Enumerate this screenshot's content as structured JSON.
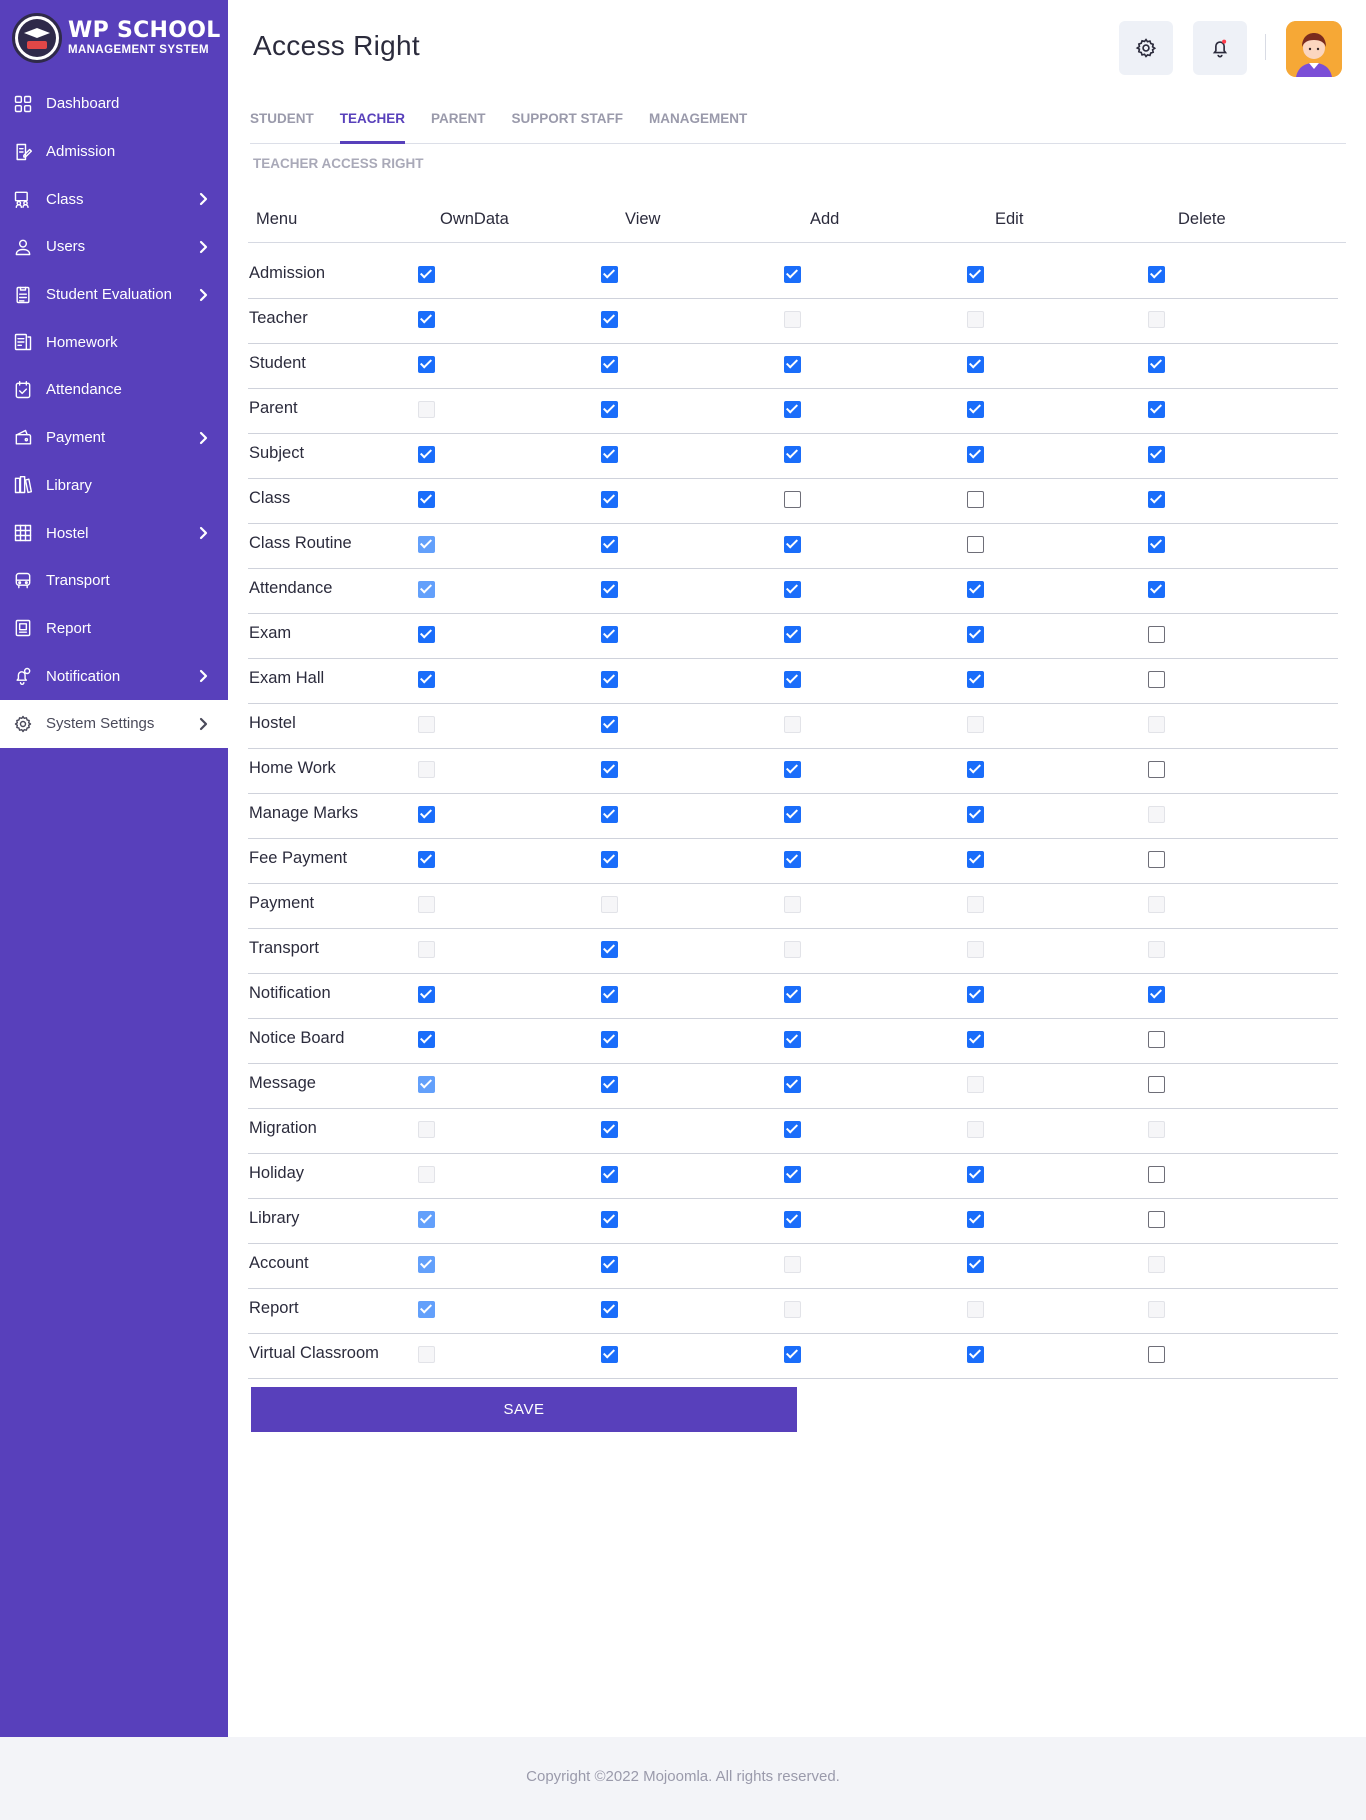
{
  "brand": {
    "title": "WP SCHOOL",
    "subtitle": "MANAGEMENT SYSTEM"
  },
  "sidebar": {
    "items": [
      {
        "label": "Dashboard",
        "icon": "dashboard-icon",
        "has_submenu": false
      },
      {
        "label": "Admission",
        "icon": "admission-icon",
        "has_submenu": false
      },
      {
        "label": "Class",
        "icon": "class-icon",
        "has_submenu": true
      },
      {
        "label": "Users",
        "icon": "users-icon",
        "has_submenu": true
      },
      {
        "label": "Student Evaluation",
        "icon": "evaluation-icon",
        "has_submenu": true
      },
      {
        "label": "Homework",
        "icon": "homework-icon",
        "has_submenu": false
      },
      {
        "label": "Attendance",
        "icon": "attendance-icon",
        "has_submenu": false
      },
      {
        "label": "Payment",
        "icon": "payment-icon",
        "has_submenu": true
      },
      {
        "label": "Library",
        "icon": "library-icon",
        "has_submenu": false
      },
      {
        "label": "Hostel",
        "icon": "hostel-icon",
        "has_submenu": true
      },
      {
        "label": "Transport",
        "icon": "transport-icon",
        "has_submenu": false
      },
      {
        "label": "Report",
        "icon": "report-icon",
        "has_submenu": false
      },
      {
        "label": "Notification",
        "icon": "notification-icon",
        "has_submenu": true
      },
      {
        "label": "System Settings",
        "icon": "settings-icon",
        "has_submenu": true,
        "active": true
      }
    ]
  },
  "header": {
    "title": "Access Right",
    "settings_icon": "gear-icon",
    "notification_icon": "bell-icon"
  },
  "tabs": [
    {
      "label": "STUDENT",
      "active": false
    },
    {
      "label": "TEACHER",
      "active": true
    },
    {
      "label": "PARENT",
      "active": false
    },
    {
      "label": "SUPPORT STAFF",
      "active": false
    },
    {
      "label": "MANAGEMENT",
      "active": false
    }
  ],
  "section_title": "TEACHER ACCESS RIGHT",
  "table": {
    "columns": [
      "Menu",
      "OwnData",
      "View",
      "Add",
      "Edit",
      "Delete"
    ],
    "state_legend": {
      "c": "checked",
      "cd": "checked-disabled",
      "u": "unchecked",
      "d": "disabled"
    },
    "rows": [
      {
        "menu": "Admission",
        "perms": [
          "c",
          "c",
          "c",
          "c",
          "c"
        ]
      },
      {
        "menu": "Teacher",
        "perms": [
          "c",
          "c",
          "d",
          "d",
          "d"
        ]
      },
      {
        "menu": "Student",
        "perms": [
          "c",
          "c",
          "c",
          "c",
          "c"
        ]
      },
      {
        "menu": "Parent",
        "perms": [
          "d",
          "c",
          "c",
          "c",
          "c"
        ]
      },
      {
        "menu": "Subject",
        "perms": [
          "c",
          "c",
          "c",
          "c",
          "c"
        ]
      },
      {
        "menu": "Class",
        "perms": [
          "c",
          "c",
          "u",
          "u",
          "c"
        ]
      },
      {
        "menu": "Class Routine",
        "perms": [
          "cd",
          "c",
          "c",
          "u",
          "c"
        ]
      },
      {
        "menu": "Attendance",
        "perms": [
          "cd",
          "c",
          "c",
          "c",
          "c"
        ]
      },
      {
        "menu": "Exam",
        "perms": [
          "c",
          "c",
          "c",
          "c",
          "u"
        ]
      },
      {
        "menu": "Exam Hall",
        "perms": [
          "c",
          "c",
          "c",
          "c",
          "u"
        ]
      },
      {
        "menu": "Hostel",
        "perms": [
          "d",
          "c",
          "d",
          "d",
          "d"
        ]
      },
      {
        "menu": "Home Work",
        "perms": [
          "d",
          "c",
          "c",
          "c",
          "u"
        ]
      },
      {
        "menu": "Manage Marks",
        "perms": [
          "c",
          "c",
          "c",
          "c",
          "d"
        ]
      },
      {
        "menu": "Fee Payment",
        "perms": [
          "c",
          "c",
          "c",
          "c",
          "u"
        ]
      },
      {
        "menu": "Payment",
        "perms": [
          "d",
          "d",
          "d",
          "d",
          "d"
        ]
      },
      {
        "menu": "Transport",
        "perms": [
          "d",
          "c",
          "d",
          "d",
          "d"
        ]
      },
      {
        "menu": "Notification",
        "perms": [
          "c",
          "c",
          "c",
          "c",
          "c"
        ]
      },
      {
        "menu": "Notice Board",
        "perms": [
          "c",
          "c",
          "c",
          "c",
          "u"
        ]
      },
      {
        "menu": "Message",
        "perms": [
          "cd",
          "c",
          "c",
          "d",
          "u"
        ]
      },
      {
        "menu": "Migration",
        "perms": [
          "d",
          "c",
          "c",
          "d",
          "d"
        ]
      },
      {
        "menu": "Holiday",
        "perms": [
          "d",
          "c",
          "c",
          "c",
          "u"
        ]
      },
      {
        "menu": "Library",
        "perms": [
          "cd",
          "c",
          "c",
          "c",
          "u"
        ]
      },
      {
        "menu": "Account",
        "perms": [
          "cd",
          "c",
          "d",
          "c",
          "d"
        ]
      },
      {
        "menu": "Report",
        "perms": [
          "cd",
          "c",
          "d",
          "d",
          "d"
        ]
      },
      {
        "menu": "Virtual Classroom",
        "perms": [
          "d",
          "c",
          "c",
          "c",
          "u"
        ]
      }
    ]
  },
  "save_label": "SAVE",
  "footer": {
    "copyright": "Copyright ©2022 Mojoomla. All rights reserved."
  },
  "colors": {
    "sidebar": "#5840bb",
    "accent": "#5840bb",
    "checkbox": "#1a6dfa",
    "avatar_bg": "#f6a836"
  }
}
